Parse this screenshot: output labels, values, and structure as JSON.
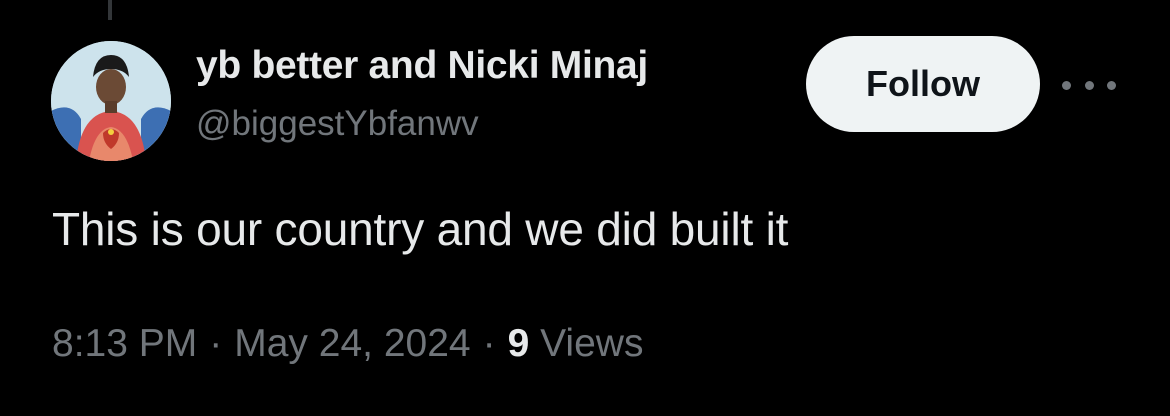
{
  "author": {
    "display_name": "yb better and Nicki Minaj",
    "handle": "@biggestYbfanwv",
    "avatar_icon": "avatar-portrait-icon"
  },
  "actions": {
    "follow_label": "Follow",
    "more_icon": "more-options-icon"
  },
  "tweet": {
    "text": "This is our country and we did built it",
    "time": "8:13 PM",
    "date": "May 24, 2024",
    "separator": "·",
    "views_count": "9",
    "views_label": "Views"
  },
  "colors": {
    "background": "#000000",
    "primary_text": "#e7e9ea",
    "secondary_text": "#71767b",
    "follow_bg": "#eff3f4",
    "follow_text": "#0f1419"
  }
}
